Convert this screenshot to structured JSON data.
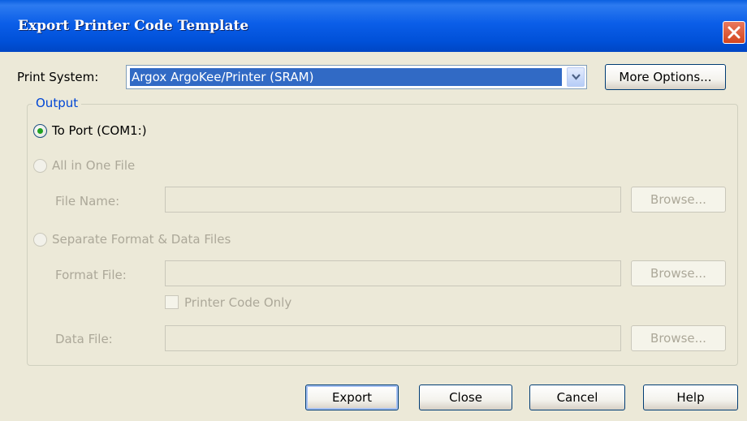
{
  "window": {
    "title": "Export Printer Code Template"
  },
  "print_system": {
    "label": "Print System:",
    "selected": "Argox ArgoKee/Printer (SRAM)",
    "more_options": "More Options..."
  },
  "output": {
    "legend": "Output",
    "to_port": {
      "label": "To Port (COM1:)",
      "checked": true
    },
    "all_in_one": {
      "label": "All in One File",
      "checked": false,
      "file_name_label": "File Name:",
      "file_name_value": "",
      "browse": "Browse..."
    },
    "separate": {
      "label": "Separate Format & Data Files",
      "checked": false,
      "format_file_label": "Format File:",
      "format_file_value": "",
      "format_browse": "Browse...",
      "printer_code_only": "Printer Code Only",
      "data_file_label": "Data File:",
      "data_file_value": "",
      "data_browse": "Browse..."
    }
  },
  "buttons": {
    "export": "Export",
    "close": "Close",
    "cancel": "Cancel",
    "help": "Help"
  },
  "colors": {
    "title_bar": "#0054e3",
    "selection": "#316ac5",
    "group_legend": "#0046d5",
    "disabled_text": "#aca899",
    "radio_dot": "#21a121"
  },
  "icons": {
    "close": "close-icon",
    "dropdown": "chevron-down-icon"
  }
}
